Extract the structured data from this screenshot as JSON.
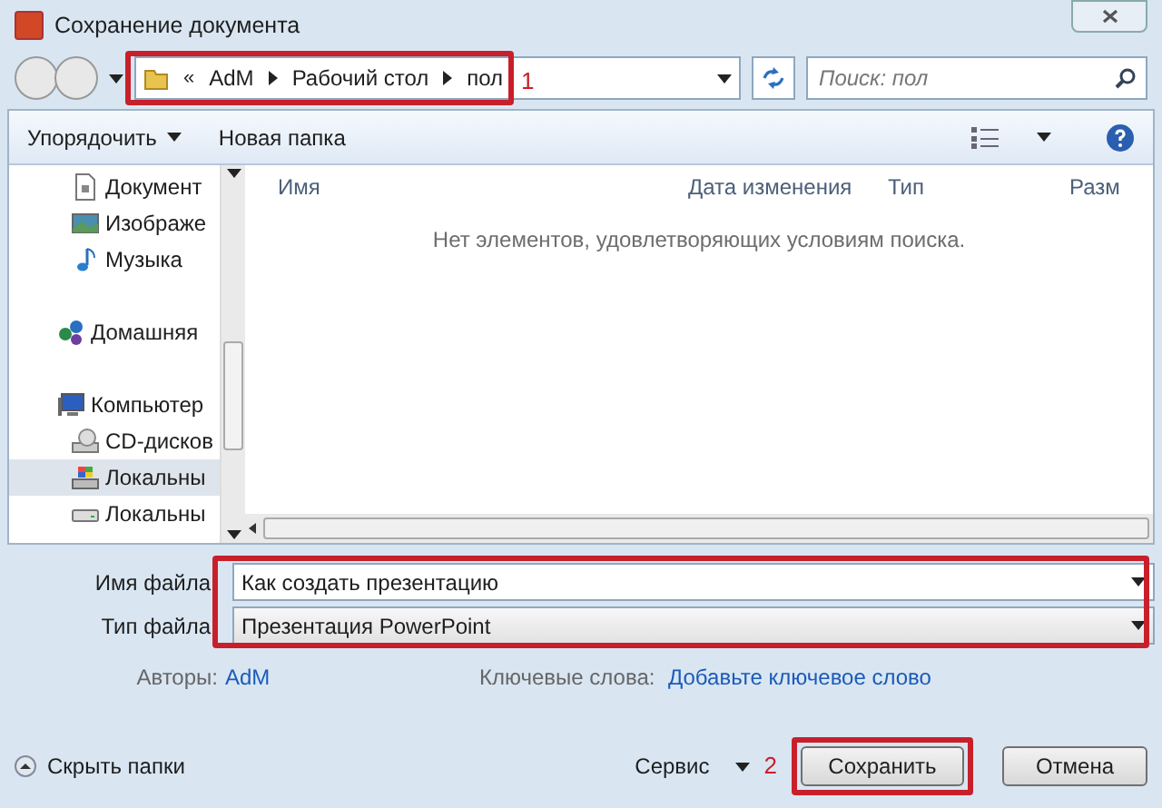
{
  "window": {
    "title": "Сохранение документа"
  },
  "address": {
    "overflow": "«",
    "segments": [
      "AdM",
      "Рабочий стол",
      "пол"
    ],
    "search_placeholder": "Поиск: пол",
    "annotation": "1"
  },
  "toolbar": {
    "organize": "Упорядочить",
    "new_folder": "Новая папка"
  },
  "sidebar": {
    "groups": [
      {
        "items": [
          {
            "label": "Документ",
            "kind": "document",
            "selected": false
          },
          {
            "label": "Изображе",
            "kind": "image",
            "selected": false
          },
          {
            "label": "Музыка",
            "kind": "music",
            "selected": false
          }
        ]
      },
      {
        "items": [
          {
            "label": "Домашняя",
            "kind": "homegroup",
            "selected": false
          }
        ]
      },
      {
        "items": [
          {
            "label": "Компьютер",
            "kind": "computer",
            "selected": false
          },
          {
            "label": "CD-дисков",
            "kind": "cd",
            "selected": false
          },
          {
            "label": "Локальны",
            "kind": "windisk",
            "selected": true
          },
          {
            "label": "Локальны",
            "kind": "disk",
            "selected": false
          }
        ]
      }
    ]
  },
  "table": {
    "columns": [
      "Имя",
      "Дата изменения",
      "Тип",
      "Разм"
    ],
    "empty_message": "Нет элементов, удовлетворяющих условиям поиска."
  },
  "form": {
    "file_name_label": "Имя файла",
    "file_name": "Как создать презентацию",
    "file_type_label": "Тип файла",
    "file_type": "Презентация PowerPoint",
    "authors_label": "Авторы:",
    "authors": "AdM",
    "keywords_label": "Ключевые слова:",
    "keywords": "Добавьте ключевое слово"
  },
  "footer": {
    "hide_folders": "Скрыть папки",
    "service": "Сервис",
    "annotation": "2",
    "save": "Сохранить",
    "cancel": "Отмена"
  }
}
